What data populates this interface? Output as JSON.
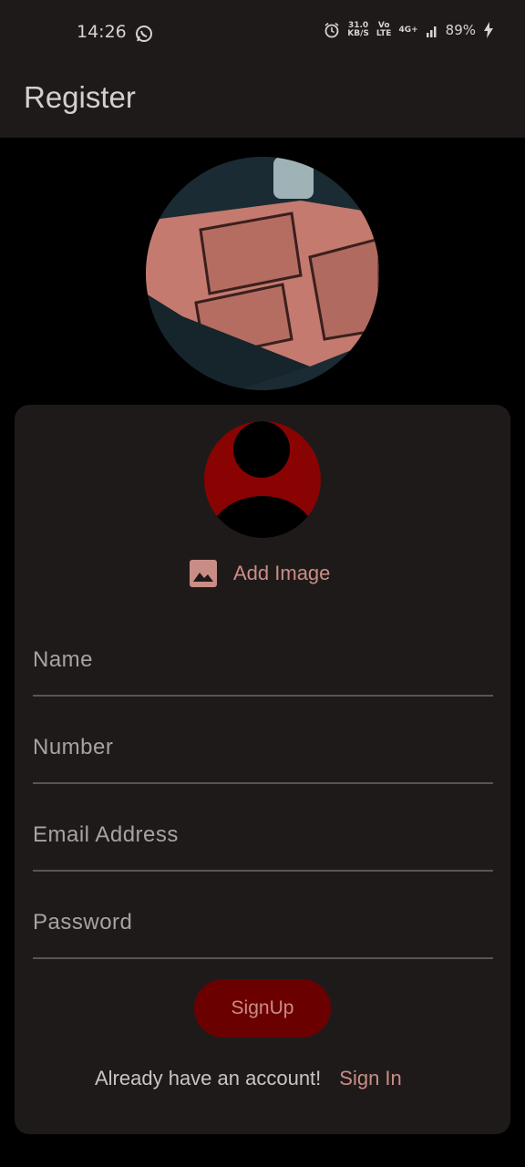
{
  "status_bar": {
    "time": "14:26",
    "net_speed_value": "31.0",
    "net_speed_unit": "KB/S",
    "volte_top": "Vo",
    "volte_bottom": "LTE",
    "network": "4G+",
    "battery": "89%",
    "icons": [
      "whatsapp-icon",
      "alarm-icon",
      "signal-icon",
      "charging-icon"
    ]
  },
  "app_bar": {
    "title": "Register"
  },
  "hero": {
    "image": "ticket-coupon-photo"
  },
  "form": {
    "avatar_icon": "user-avatar-icon",
    "add_image_label": "Add Image",
    "fields": [
      {
        "label": "Name"
      },
      {
        "label": "Number"
      },
      {
        "label": "Email Address"
      },
      {
        "label": "Password"
      }
    ],
    "signup_label": "SignUp",
    "already_text": "Already have an account!",
    "signin_label": "Sign In"
  },
  "colors": {
    "background": "#000000",
    "surface": "#1f1a1a",
    "accent": "#8a0303",
    "button": "#6b0000",
    "link": "#c98d86"
  }
}
